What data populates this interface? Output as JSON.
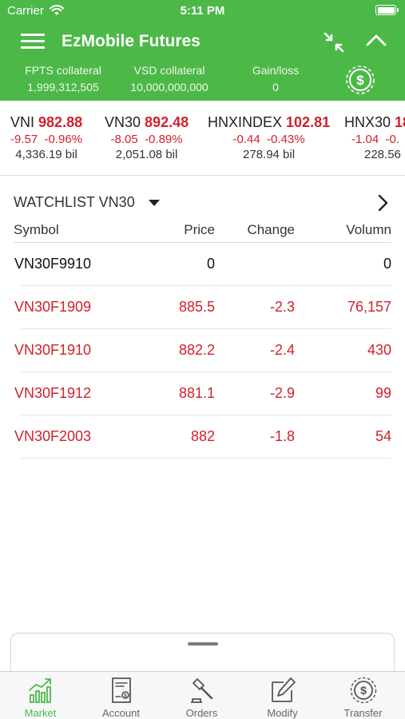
{
  "status_bar": {
    "carrier": "Carrier",
    "time": "5:11 PM"
  },
  "header": {
    "title": "EzMobile Futures",
    "collateral": [
      {
        "label": "FPTS collateral",
        "value": "1,999,312,505"
      },
      {
        "label": "VSD collateral",
        "value": "10,000,000,000"
      },
      {
        "label": "Gain/loss",
        "value": "0"
      }
    ]
  },
  "indices": [
    {
      "name": "VNI",
      "value": "982.88",
      "change": "-9.57",
      "pct": "-0.96%",
      "volume": "4,336.19 bil"
    },
    {
      "name": "VN30",
      "value": "892.48",
      "change": "-8.05",
      "pct": "-0.89%",
      "volume": "2,051.08 bil"
    },
    {
      "name": "HNXINDEX",
      "value": "102.81",
      "change": "-0.44",
      "pct": "-0.43%",
      "volume": "278.94 bil"
    },
    {
      "name": "HNX30",
      "value": "18",
      "change": "-1.04",
      "pct": "-0.",
      "volume": "228.56"
    }
  ],
  "watchlist": {
    "title": "WATCHLIST VN30",
    "columns": {
      "symbol": "Symbol",
      "price": "Price",
      "change": "Change",
      "volume": "Volumn"
    },
    "rows": [
      {
        "symbol": "VN30F9910",
        "price": "0",
        "change": "",
        "volume": "0",
        "tone": "neutral"
      },
      {
        "symbol": "VN30F1909",
        "price": "885.5",
        "change": "-2.3",
        "volume": "76,157",
        "tone": "red"
      },
      {
        "symbol": "VN30F1910",
        "price": "882.2",
        "change": "-2.4",
        "volume": "430",
        "tone": "red"
      },
      {
        "symbol": "VN30F1912",
        "price": "881.1",
        "change": "-2.9",
        "volume": "99",
        "tone": "red"
      },
      {
        "symbol": "VN30F2003",
        "price": "882",
        "change": "-1.8",
        "volume": "54",
        "tone": "red"
      }
    ]
  },
  "tabs": [
    {
      "label": "Market",
      "icon": "chart-icon",
      "active": true
    },
    {
      "label": "Account",
      "icon": "account-icon",
      "active": false
    },
    {
      "label": "Orders",
      "icon": "gavel-icon",
      "active": false
    },
    {
      "label": "Modify",
      "icon": "edit-icon",
      "active": false
    },
    {
      "label": "Transfer",
      "icon": "transfer-icon",
      "active": false
    }
  ],
  "colors": {
    "brand_green": "#4cb848",
    "down_red": "#d0222b",
    "neutral_text": "#111111"
  }
}
